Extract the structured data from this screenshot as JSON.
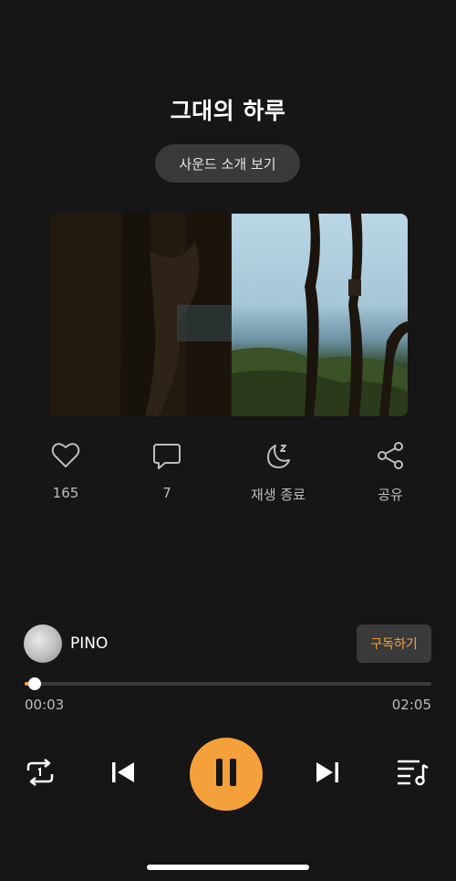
{
  "track": {
    "title": "그대의 하루",
    "sound_info_label": "사운드 소개 보기"
  },
  "actions": {
    "like_count": "165",
    "comment_count": "7",
    "sleep_timer_label": "재생 종료",
    "share_label": "공유"
  },
  "artist": {
    "name": "PINO",
    "subscribe_label": "구독하기"
  },
  "player": {
    "current_time": "00:03",
    "total_time": "02:05",
    "progress_fraction": 0.024,
    "state": "playing"
  },
  "colors": {
    "accent": "#f5a13b",
    "background": "#161616",
    "button_bg": "#3a3a3a"
  },
  "icons": [
    "heart-icon",
    "comment-icon",
    "sleep-timer-icon",
    "share-icon",
    "repeat-icon",
    "previous-icon",
    "pause-icon",
    "next-icon",
    "playlist-icon"
  ]
}
